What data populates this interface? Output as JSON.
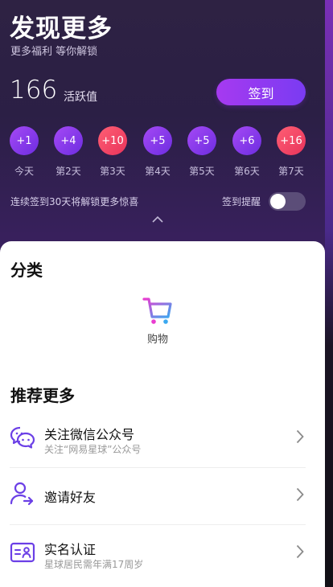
{
  "header": {
    "title": "发现更多",
    "subtitle": "更多福利 等你解锁",
    "score": "166",
    "score_label": "活跃值",
    "checkin_button": "签到"
  },
  "days": [
    {
      "reward": "+1",
      "label": "今天",
      "color": "purple"
    },
    {
      "reward": "+4",
      "label": "第2天",
      "color": "purple"
    },
    {
      "reward": "+10",
      "label": "第3天",
      "color": "red"
    },
    {
      "reward": "+5",
      "label": "第4天",
      "color": "purple"
    },
    {
      "reward": "+5",
      "label": "第5天",
      "color": "purple"
    },
    {
      "reward": "+6",
      "label": "第6天",
      "color": "purple"
    },
    {
      "reward": "+16",
      "label": "第7天",
      "color": "red"
    }
  ],
  "streak_hint": "连续签到30天将解锁更多惊喜",
  "reminder": {
    "label": "签到提醒",
    "enabled": false
  },
  "categories": {
    "title": "分类",
    "items": [
      {
        "label": "购物",
        "icon": "shopping-cart-icon"
      }
    ]
  },
  "recommend": {
    "title": "推荐更多",
    "items": [
      {
        "title": "关注微信公众号",
        "subtitle": "关注“网易星球”公众号",
        "icon": "wechat-icon"
      },
      {
        "title": "邀请好友",
        "subtitle": "",
        "icon": "invite-user-icon"
      },
      {
        "title": "实名认证",
        "subtitle": "星球居民需年满17周岁",
        "icon": "id-card-icon"
      }
    ]
  },
  "colors": {
    "accent_purple": "#7a3bf2",
    "accent_red": "#e8335b",
    "header_bg": "#2b1f45"
  }
}
